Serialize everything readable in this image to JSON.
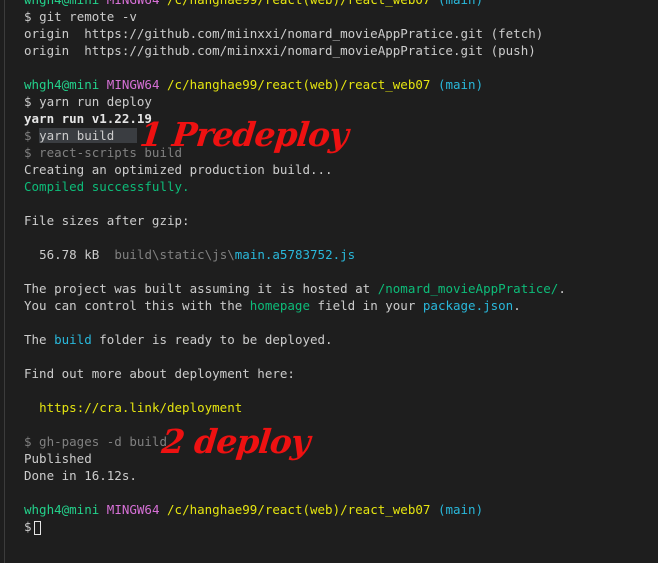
{
  "terminal": {
    "prompt_user": "whgh4@mini",
    "prompt_env": "MINGW64",
    "prompt_path": "/c/hanghae99/react(web)/react_web07",
    "prompt_branch": "(main)",
    "prompt_symbol": "$",
    "lines": {
      "cmd_remote": "git remote -v",
      "remote_fetch": "origin  https://github.com/miinxxi/nomard_movieAppPratice.git (fetch)",
      "remote_push": "origin  https://github.com/miinxxi/nomard_movieAppPratice.git (push)",
      "cmd_deploy": "yarn run deploy",
      "yarn_version": "yarn run v1.22.19",
      "cmd_yarn_build": "yarn build",
      "cmd_react_scripts": "$ react-scripts build",
      "creating_build": "Creating an optimized production build...",
      "compiled": "Compiled successfully.",
      "file_sizes": "File sizes after gzip:",
      "file_size": "56.78 kB",
      "file_dir": "build\\static\\js\\",
      "file_name": "main.a5783752.js",
      "hosted_prefix": "The project was built assuming it is hosted at ",
      "hosted_path": "/nomard_movieAppPratice/",
      "hosted_suffix": ".",
      "control_prefix": "You can control this with the ",
      "control_homepage": "homepage",
      "control_mid": " field in your ",
      "control_package": "package.json",
      "control_suffix": ".",
      "ready_prefix": "The ",
      "ready_build": "build",
      "ready_suffix": " folder is ready to be deployed.",
      "find_out": "Find out more about deployment here:",
      "deploy_link": "https://cra.link/deployment",
      "cmd_ghpages": "$ gh-pages -d build",
      "published": "Published",
      "done": "Done in 16.12s."
    }
  },
  "annotations": {
    "predeploy": "1 Predeploy",
    "deploy": "2 deploy"
  }
}
